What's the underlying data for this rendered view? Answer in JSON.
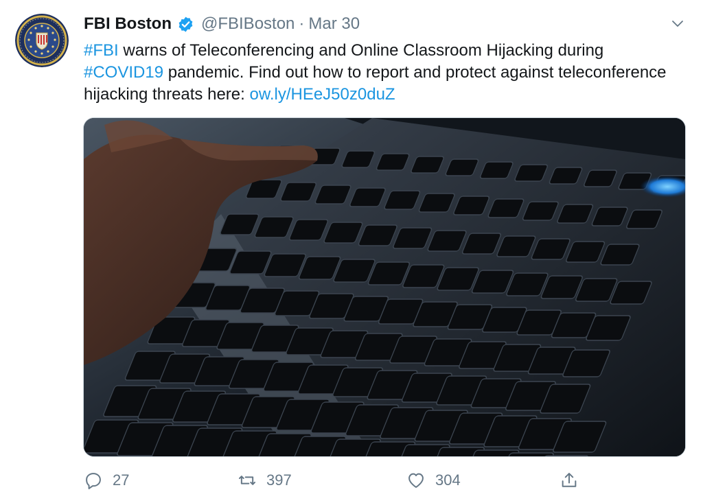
{
  "tweet": {
    "author_name": "FBI Boston",
    "handle": "@FBIBoston",
    "separator": "·",
    "date": "Mar 30",
    "text": {
      "hashtag_fbi": "#FBI",
      "segment_1": " warns of Teleconferencing and Online Classroom Hijacking during ",
      "hashtag_covid": "#COVID19",
      "segment_2": " pandemic. Find out how to report and protect against teleconference hijacking threats here: ",
      "link": "ow.ly/HEeJ50z0duZ"
    },
    "media": {
      "description_icon": "photo-keyboard-hand"
    },
    "actions": {
      "replies": "27",
      "retweets": "397",
      "likes": "304"
    },
    "icons": {
      "verified": "verified-badge-icon",
      "caret": "chevron-down-icon",
      "reply": "reply-icon",
      "retweet": "retweet-icon",
      "like": "heart-icon",
      "share": "share-icon"
    }
  },
  "colors": {
    "link": "#1b95e0",
    "secondary_text": "#657786",
    "primary_text": "#14171a",
    "verified": "#1da1f2"
  }
}
